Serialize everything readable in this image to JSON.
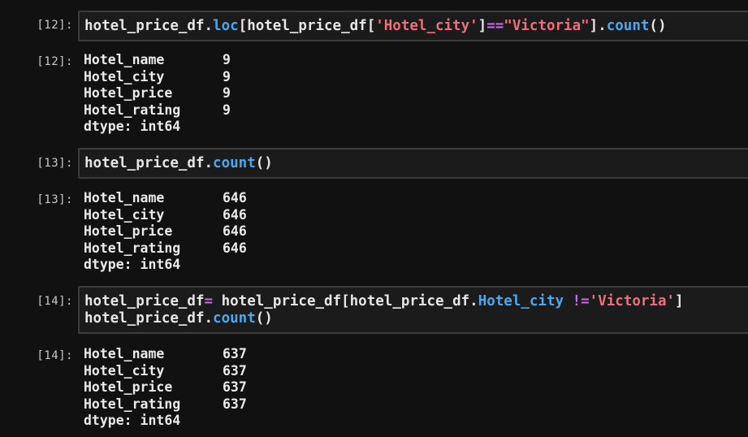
{
  "cells": [
    {
      "input_prompt": "[12]:",
      "output_prompt": "[12]:",
      "code_lines": [
        [
          {
            "text": "hotel_price_df.",
            "type": "default"
          },
          {
            "text": "loc",
            "type": "method"
          },
          {
            "text": "[hotel_price_df[",
            "type": "default"
          },
          {
            "text": "'Hotel_city'",
            "type": "string"
          },
          {
            "text": "]",
            "type": "default"
          },
          {
            "text": "==",
            "type": "operator"
          },
          {
            "text": "\"Victoria\"",
            "type": "string"
          },
          {
            "text": "].",
            "type": "default"
          },
          {
            "text": "count",
            "type": "method"
          },
          {
            "text": "()",
            "type": "default"
          }
        ]
      ],
      "output_rows": [
        {
          "key": "Hotel_name",
          "value": "9"
        },
        {
          "key": "Hotel_city",
          "value": "9"
        },
        {
          "key": "Hotel_price",
          "value": "9"
        },
        {
          "key": "Hotel_rating",
          "value": "9"
        },
        {
          "key": "dtype: int64",
          "value": ""
        }
      ]
    },
    {
      "input_prompt": "[13]:",
      "output_prompt": "[13]:",
      "code_lines": [
        [
          {
            "text": "hotel_price_df.",
            "type": "default"
          },
          {
            "text": "count",
            "type": "method"
          },
          {
            "text": "()",
            "type": "default"
          }
        ]
      ],
      "output_rows": [
        {
          "key": "Hotel_name",
          "value": "646"
        },
        {
          "key": "Hotel_city",
          "value": "646"
        },
        {
          "key": "Hotel_price",
          "value": "646"
        },
        {
          "key": "Hotel_rating",
          "value": "646"
        },
        {
          "key": "dtype: int64",
          "value": ""
        }
      ]
    },
    {
      "input_prompt": "[14]:",
      "output_prompt": "[14]:",
      "code_lines": [
        [
          {
            "text": "hotel_price_df",
            "type": "default"
          },
          {
            "text": "=",
            "type": "operator"
          },
          {
            "text": " hotel_price_df[hotel_price_df.",
            "type": "default"
          },
          {
            "text": "Hotel_city",
            "type": "method"
          },
          {
            "text": " ",
            "type": "default"
          },
          {
            "text": "!=",
            "type": "operator"
          },
          {
            "text": "'Victoria'",
            "type": "string"
          },
          {
            "text": "]",
            "type": "default"
          }
        ],
        [
          {
            "text": "hotel_price_df.",
            "type": "default"
          },
          {
            "text": "count",
            "type": "method"
          },
          {
            "text": "()",
            "type": "default"
          }
        ]
      ],
      "output_rows": [
        {
          "key": "Hotel_name",
          "value": "637"
        },
        {
          "key": "Hotel_city",
          "value": "637"
        },
        {
          "key": "Hotel_price",
          "value": "637"
        },
        {
          "key": "Hotel_rating",
          "value": "637"
        },
        {
          "key": "dtype: int64",
          "value": ""
        }
      ]
    }
  ],
  "colors": {
    "background": "#111111",
    "input_background": "#1b1b1b",
    "input_border": "#3c3c3c",
    "method": "#4aa8f2",
    "string": "#f06d7c",
    "operator": "#cc6de8",
    "text": "#e6e6e6"
  }
}
